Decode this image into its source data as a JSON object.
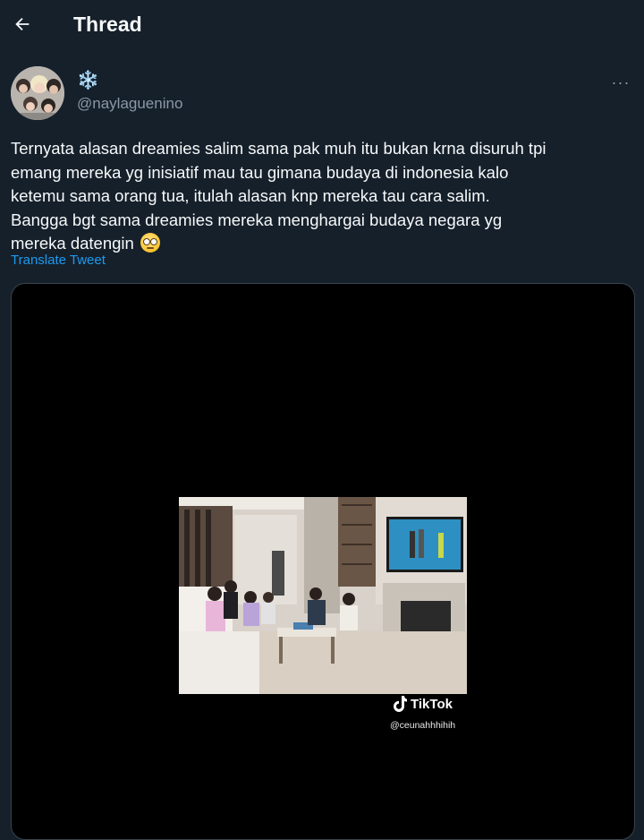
{
  "header": {
    "title": "Thread",
    "back_icon": "arrow-left-icon"
  },
  "tweet": {
    "display_name": "❄️",
    "handle": "@naylaguenino",
    "more_icon": "more-horizontal-icon",
    "more_label": "···",
    "text": "Ternyata alasan dreamies salim sama pak muh itu bukan krna disuruh tpi\nemang mereka yg inisiatif mau tau gimana budaya di indonesia kalo\nketemu sama orang tua, itulah alasan knp mereka tau cara salim.\nBangga bgt sama dreamies mereka menghargai budaya negara yg\nmereka datengin ",
    "translate_label": "Translate Tweet"
  },
  "media": {
    "watermark_brand": "TikTok",
    "watermark_handle": "@ceunahhhihih"
  },
  "colors": {
    "background": "#15202b",
    "accent": "#1d9bf0",
    "secondary_text": "#8b98a5"
  }
}
